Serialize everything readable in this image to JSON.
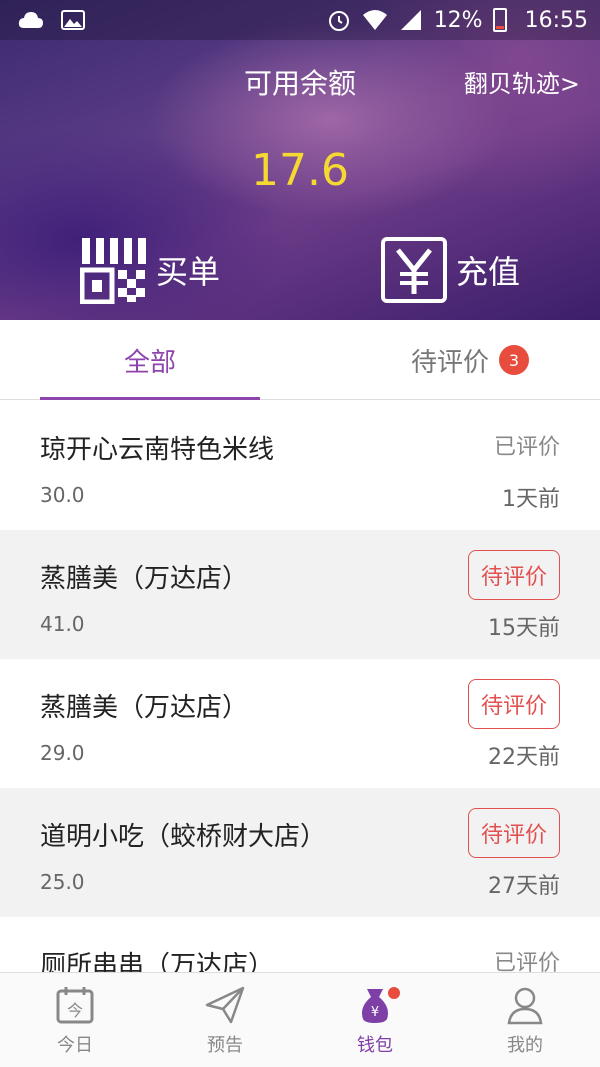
{
  "status_bar": {
    "battery": "12%",
    "time": "16:55"
  },
  "hero": {
    "title": "可用余额",
    "link": "翻贝轨迹>",
    "balance": "17.6",
    "buy_label": "买单",
    "topup_label": "充值",
    "balance_color": "#f5d931"
  },
  "tabs": {
    "all": "全部",
    "pending": "待评价",
    "pending_count": "3",
    "accent": "#8e44ad"
  },
  "orders": [
    {
      "shop": "琼开心云南特色米线",
      "amount": "30.0",
      "status": "已评价",
      "time": "1天前",
      "pending": false
    },
    {
      "shop": "蒸膳美（万达店）",
      "amount": "41.0",
      "status": "待评价",
      "time": "15天前",
      "pending": true
    },
    {
      "shop": "蒸膳美（万达店）",
      "amount": "29.0",
      "status": "待评价",
      "time": "22天前",
      "pending": true
    },
    {
      "shop": "道明小吃（蛟桥财大店）",
      "amount": "25.0",
      "status": "待评价",
      "time": "27天前",
      "pending": true
    },
    {
      "shop": "厕所串串（万达店）",
      "amount": "",
      "status": "已评价",
      "time": "",
      "pending": false
    }
  ],
  "bottom_nav": [
    {
      "label": "今日",
      "icon": "calendar-icon"
    },
    {
      "label": "预告",
      "icon": "paper-plane-icon"
    },
    {
      "label": "钱包",
      "icon": "wallet-icon"
    },
    {
      "label": "我的",
      "icon": "user-icon"
    }
  ]
}
